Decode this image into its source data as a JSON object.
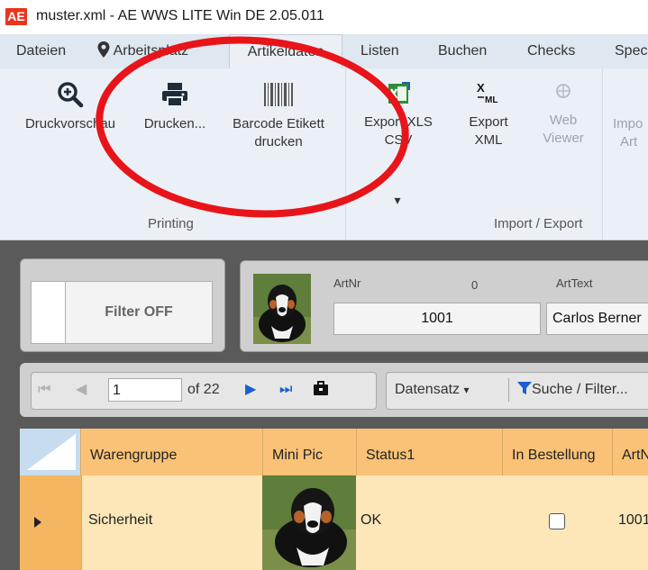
{
  "window": {
    "logo": "AE",
    "title": "muster.xml - AE WWS LITE Win DE 2.05.011"
  },
  "menu": {
    "tabs": [
      "Dateien",
      "Arbeitsplatz",
      "Artikeldaten",
      "Listen",
      "Buchen",
      "Checks",
      "Spec"
    ],
    "active": "Artikeldaten"
  },
  "ribbon": {
    "buttons": {
      "druckvorschau": "Druckvorschau",
      "drucken": "Drucken...",
      "barcode_line1": "Barcode Etikett",
      "barcode_line2": "drucken",
      "export_xls_line1": "Export XLS",
      "export_xls_line2": "CSV",
      "export_xml_line1": "Export",
      "export_xml_line2": "XML",
      "web_viewer_line1": "Web",
      "web_viewer_line2": "Viewer",
      "import_line1": "Impo",
      "import_line2": "Art"
    },
    "groups": {
      "printing": "Printing",
      "import_export": "Import / Export"
    },
    "dropdown_glyph": "▾"
  },
  "filter": {
    "label": "Filter OFF"
  },
  "record": {
    "artnr_label": "ArtNr",
    "zero_label": "0",
    "arttext_label": "ArtText",
    "artnr_value": "1001",
    "arttext_value": "Carlos Berner"
  },
  "navigator": {
    "position": "1",
    "of_total": "of 22",
    "datensatz": "Datensatz",
    "suche": "Suche / Filter..."
  },
  "grid": {
    "columns": [
      "Warengruppe",
      "Mini Pic",
      "Status1",
      "In Bestellung",
      "ArtN"
    ],
    "rows": [
      {
        "warengruppe": "Sicherheit",
        "status1": "OK",
        "in_bestellung": false,
        "artnr": "1001"
      }
    ]
  },
  "colors": {
    "annotation": "#e8141a",
    "header": "#f9c276",
    "row": "#fde7b8",
    "workspace": "#5a5a5a",
    "ribbon": "#ebf0f6"
  },
  "icons": [
    "zoom-in-icon",
    "printer-icon",
    "barcode-icon",
    "excel-export-icon",
    "xml-export-icon",
    "web-viewer-icon",
    "location-pin-icon",
    "filter-funnel-icon"
  ]
}
